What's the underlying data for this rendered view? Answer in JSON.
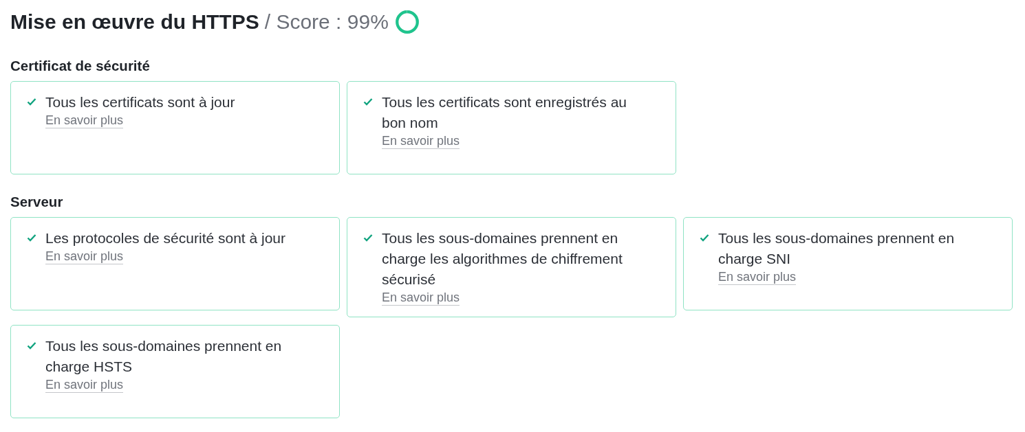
{
  "header": {
    "title": "Mise en œuvre du HTTPS",
    "score_label": "/ Score : 99%",
    "score_ring": {
      "level": 0.99
    }
  },
  "sections": [
    {
      "title": "Certificat de sécurité",
      "items": [
        {
          "text": "Tous les certificats sont à jour",
          "passed": true,
          "link": "En savoir plus"
        },
        {
          "text": "Tous les certificats sont enregistrés au bon nom",
          "passed": true,
          "link": "En savoir plus"
        }
      ]
    },
    {
      "title": "Serveur",
      "items": [
        {
          "text": "Les protocoles de sécurité sont à jour",
          "passed": true,
          "link": "En savoir plus"
        },
        {
          "text": "Tous les sous-domaines prennent en charge les algorithmes de chiffrement sécurisé",
          "passed": true,
          "link": "En savoir plus"
        },
        {
          "text": "Tous les sous-domaines prennent en charge SNI",
          "passed": true,
          "link": "En savoir plus"
        },
        {
          "text": "Tous les sous-domaines prennent en charge HSTS",
          "passed": true,
          "link": "En savoir plus"
        }
      ]
    }
  ]
}
